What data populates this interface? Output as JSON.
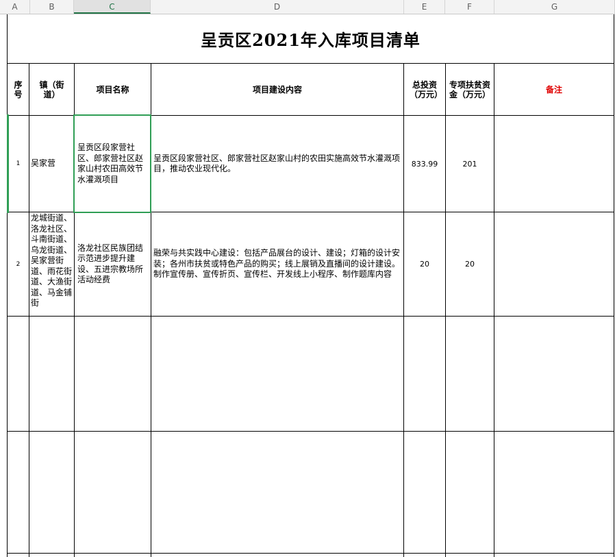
{
  "columns": [
    "A",
    "B",
    "C",
    "D",
    "E",
    "F",
    "G"
  ],
  "selected_column": "C",
  "title": "呈贡区2021年入库项目清单",
  "headers": {
    "seq": "序号",
    "town": "镇（街道）",
    "project_name": "项目名称",
    "content": "项目建设内容",
    "total_investment": "总投资（万元）",
    "poverty_fund": "专项扶贫资金（万元）",
    "remark": "备注"
  },
  "rows": [
    {
      "seq": "1",
      "town": "吴家营",
      "project_name": "呈贡区段家营社区、郎家营社区赵家山村农田高效节水灌溉项目",
      "content": "呈贡区段家营社区、郎家营社区赵家山村的农田实施高效节水灌溉项目，推动农业现代化。",
      "total_investment": "833.99",
      "poverty_fund": "201",
      "remark": ""
    },
    {
      "seq": "2",
      "town": "龙城街道、洛龙社区、斗南街道、乌龙街道、吴家营街道、雨花街道、大渔街道、马金铺街",
      "project_name": "洛龙社区民族团结示范进步提升建设、五进宗教场所活动经费",
      "content": "融荣与共实践中心建设：包括产品展台的设计、建设；灯箱的设计安装；各州市扶贫或特色产品的购买；线上展销及直播间的设计建设。制作宣传册、宣传折页、宣传栏、开发线上小程序、制作题库内容",
      "total_investment": "20",
      "poverty_fund": "20",
      "remark": ""
    }
  ]
}
